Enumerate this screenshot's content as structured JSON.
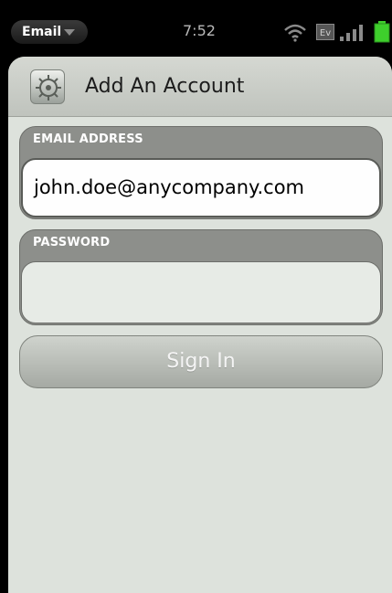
{
  "status_bar": {
    "app_menu_label": "Email",
    "time": "7:52",
    "indicators": {
      "wifi": "wifi-icon",
      "ev": "Ev",
      "signal": "signal-icon",
      "battery": "battery-icon"
    }
  },
  "header": {
    "title": "Add An Account",
    "icon": "account-settings-icon"
  },
  "email": {
    "label": "EMAIL ADDRESS",
    "value": "john.doe@anycompany.com"
  },
  "password": {
    "label": "PASSWORD",
    "value": ""
  },
  "sign_in": {
    "label": "Sign In"
  },
  "colors": {
    "card_background": "#dde2dc",
    "field_group": "#8d8f8b",
    "battery_green": "#3ecf2c"
  }
}
